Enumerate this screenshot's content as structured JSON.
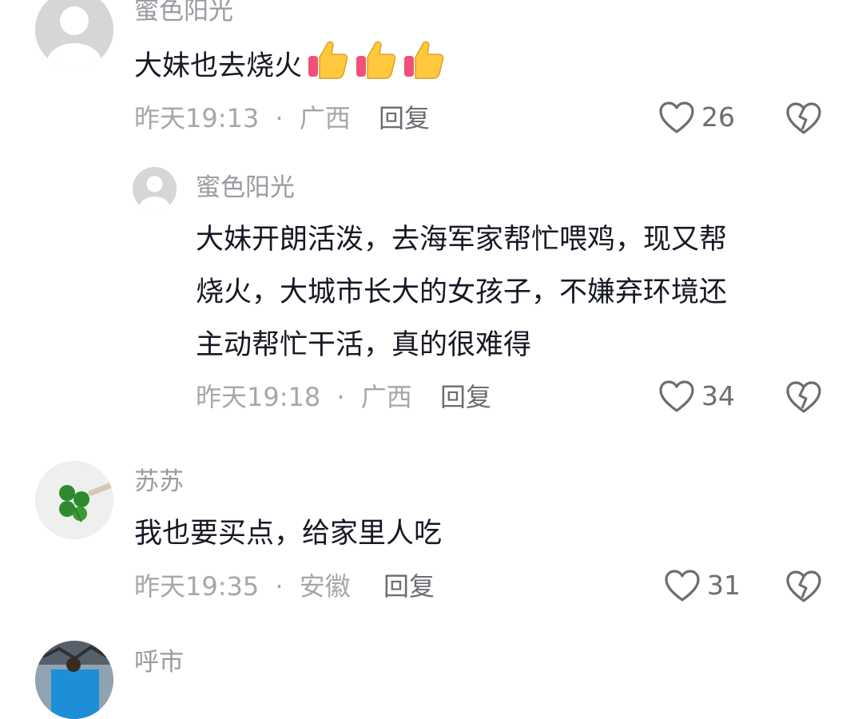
{
  "colors": {
    "like_icon": "#6c6d72",
    "meta_text": "#a6a7ab",
    "username": "#9a9ba1"
  },
  "comments": [
    {
      "username": "蜜色阳光",
      "text": "大妹也去烧火",
      "emojis": [
        "thumbs-up-emoji",
        "thumbs-up-emoji",
        "thumbs-up-emoji"
      ],
      "time": "昨天19:13",
      "location": "广西",
      "reply_label": "回复",
      "likes": "26",
      "replies": [
        {
          "username": "蜜色阳光",
          "lines": [
            "大妹开朗活泼，去海军家帮忙喂鸡，现又帮",
            "烧火，大城市长大的女孩子，不嫌弃环境还",
            "主动帮忙干活，真的很难得"
          ],
          "time": "昨天19:18",
          "location": "广西",
          "reply_label": "回复",
          "likes": "34"
        }
      ]
    },
    {
      "username": "苏苏",
      "text": "我也要买点，给家里人吃",
      "time": "昨天19:35",
      "location": "安徽",
      "reply_label": "回复",
      "likes": "31"
    },
    {
      "username": "呼市"
    }
  ],
  "separator": "·",
  "icons": {
    "like": "heart-outline-icon",
    "dislike": "broken-heart-icon",
    "avatar_placeholder": "default-avatar-icon"
  }
}
